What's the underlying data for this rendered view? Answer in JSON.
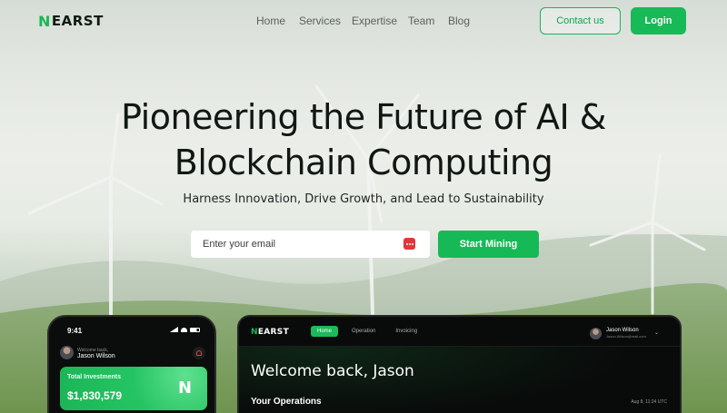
{
  "brand": {
    "logo_mark": "N",
    "logo_text": "EARST",
    "accent": "#18b957"
  },
  "nav": {
    "items": [
      "Home",
      "Services",
      "Expertise",
      "Team",
      "Blog"
    ]
  },
  "header": {
    "contact_label": "Contact us",
    "login_label": "Login"
  },
  "hero": {
    "title_line1": "Pioneering the Future of AI &",
    "title_line2": "Blockchain Computing",
    "subtitle": "Harness Innovation, Drive Growth, and Lead to Sustainability",
    "email_placeholder": "Enter your email",
    "cta_label": "Start Mining"
  },
  "phone": {
    "time": "9:41",
    "welcome": "Welcome back,",
    "user_name": "Jason Wilson",
    "card_label": "Total Investments",
    "card_amount": "$1,830,579",
    "card_mark": "N"
  },
  "dashboard": {
    "logo_mark": "N",
    "logo_text": "EARST",
    "tabs": [
      "Home",
      "Operation",
      "Invoicing"
    ],
    "user_name": "Jason Wilson",
    "user_email": "Jason.Wilson@mail.com",
    "welcome": "Welcome back, Jason",
    "section": "Your Operations",
    "date": "Aug 8, 11:24 UTC"
  }
}
